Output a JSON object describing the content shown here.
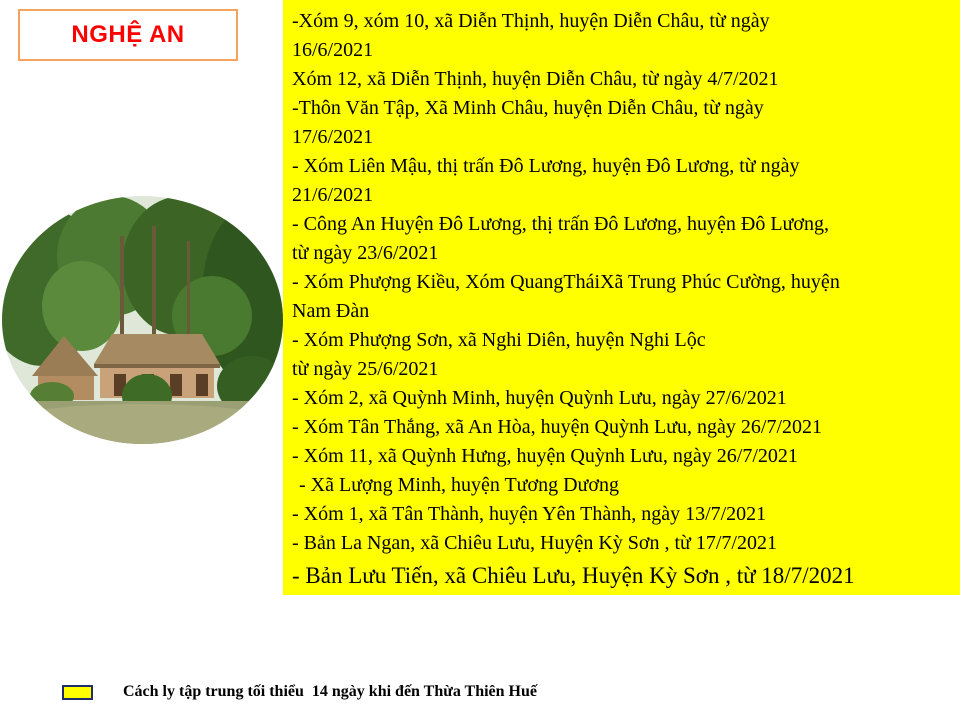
{
  "title": "NGHỆ AN",
  "photo": {
    "icon": "village-house-photo"
  },
  "locations": [
    "-Xóm 9, xóm 10, xã Diễn Thịnh, huyện Diễn Châu, từ ngày",
    "16/6/2021",
    "Xóm 12, xã Diễn Thịnh, huyện Diễn Châu, từ ngày 4/7/2021",
    "-Thôn Văn Tập,  Xã Minh Châu, huyện Diễn Châu, từ ngày",
    "17/6/2021",
    "- Xóm Liên Mậu, thị trấn Đô Lương, huyện Đô Lương, từ ngày",
    "21/6/2021",
    "- Công An Huyện Đô Lương, thị trấn Đô Lương, huyện Đô Lương,",
    "từ ngày 23/6/2021",
    "- Xóm Phượng Kiều, Xóm QuangTháiXã Trung Phúc Cường, huyện",
    "Nam Đàn",
    "- Xóm Phượng Sơn, xã Nghi Diên, huyện Nghi Lộc",
    "từ ngày 25/6/2021",
    "-    Xóm 2, xã Quỳnh Minh, huyện Quỳnh Lưu, ngày 27/6/2021",
    "-    Xóm Tân Thắng, xã An Hòa, huyện Quỳnh Lưu, ngày 26/7/2021",
    "-    Xóm 11, xã Quỳnh Hưng, huyện Quỳnh Lưu, ngày 26/7/2021",
    " - Xã Lượng Minh, huyện Tương Dương",
    "- Xóm 1, xã Tân Thành, huyện Yên Thành, ngày 13/7/2021",
    "- Bản La Ngan, xã Chiêu Lưu, Huyện Kỳ Sơn , từ 17/7/2021",
    "- Bản Lưu Tiến, xã Chiêu Lưu, Huyện Kỳ Sơn , từ 18/7/2021"
  ],
  "legend": {
    "swatch_color": "#ffff00",
    "text": "Cách ly tập trung tối thiểu  14 ngày khi đến Thừa Thiên Huế"
  },
  "colors": {
    "title": "#ff0000",
    "title_border": "#f4a35e",
    "panel": "#ffff00",
    "swatch_border": "#1f2d6b"
  }
}
